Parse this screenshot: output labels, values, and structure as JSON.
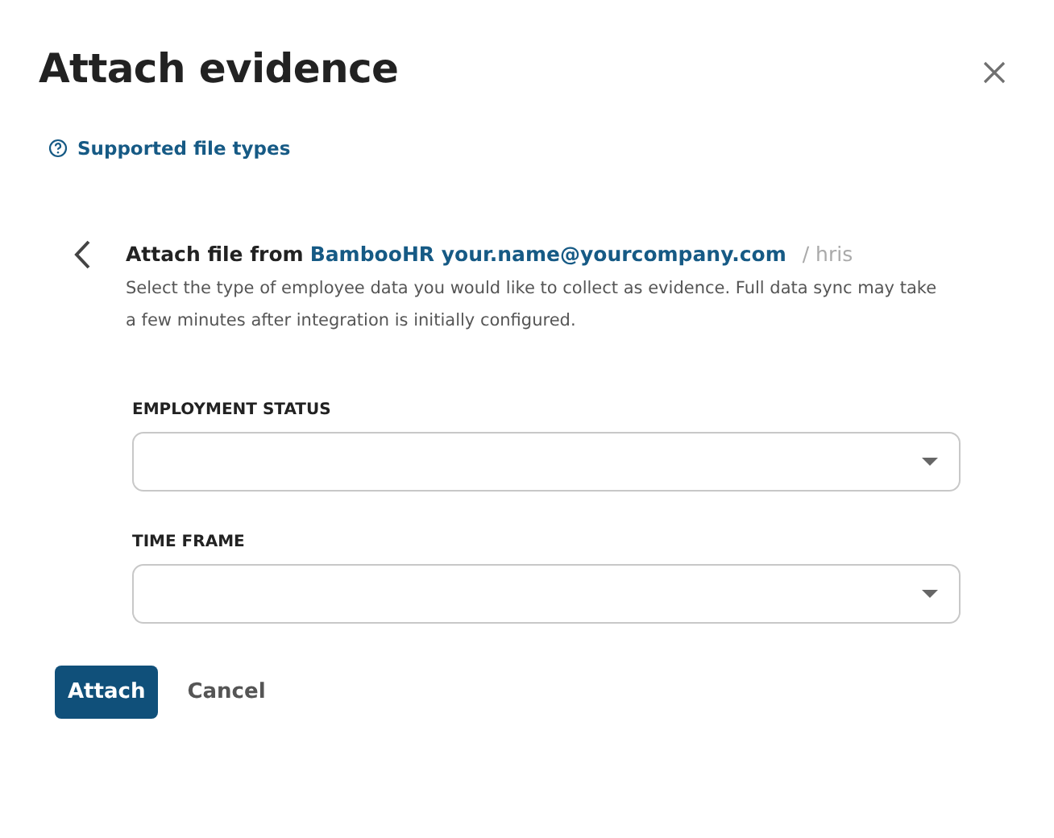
{
  "dialog": {
    "title": "Attach evidence",
    "help_link": "Supported file types"
  },
  "source": {
    "prefix": "Attach file from",
    "account": "BambooHR your.name@yourcompany.com",
    "path": "/ hris",
    "description": "Select the type of employee data you would like to collect as evidence. Full data sync may take a few minutes after integration is initially configured."
  },
  "fields": [
    {
      "label": "EMPLOYMENT STATUS"
    },
    {
      "label": "TIME FRAME"
    }
  ],
  "buttons": [
    {
      "label": "Attach",
      "kind": "primary"
    },
    {
      "label": "Cancel",
      "kind": "text"
    }
  ]
}
